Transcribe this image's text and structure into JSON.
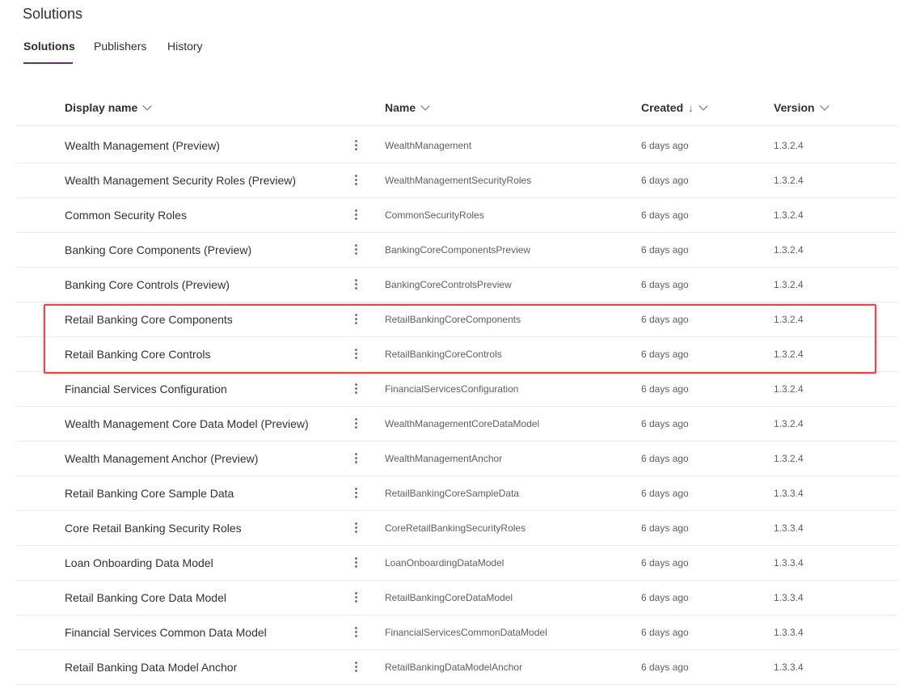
{
  "page": {
    "title": "Solutions"
  },
  "tabs": [
    {
      "label": "Solutions",
      "active": true
    },
    {
      "label": "Publishers",
      "active": false
    },
    {
      "label": "History",
      "active": false
    }
  ],
  "columns": {
    "display_name": "Display name",
    "name": "Name",
    "created": "Created",
    "created_sort_icon": "↓",
    "version": "Version"
  },
  "rows": [
    {
      "display": "Wealth Management (Preview)",
      "name": "WealthManagement",
      "created": "6 days ago",
      "version": "1.3.2.4"
    },
    {
      "display": "Wealth Management Security Roles (Preview)",
      "name": "WealthManagementSecurityRoles",
      "created": "6 days ago",
      "version": "1.3.2.4"
    },
    {
      "display": "Common Security Roles",
      "name": "CommonSecurityRoles",
      "created": "6 days ago",
      "version": "1.3.2.4"
    },
    {
      "display": "Banking Core Components (Preview)",
      "name": "BankingCoreComponentsPreview",
      "created": "6 days ago",
      "version": "1.3.2.4"
    },
    {
      "display": "Banking Core Controls (Preview)",
      "name": "BankingCoreControlsPreview",
      "created": "6 days ago",
      "version": "1.3.2.4"
    },
    {
      "display": "Retail Banking Core Components",
      "name": "RetailBankingCoreComponents",
      "created": "6 days ago",
      "version": "1.3.2.4"
    },
    {
      "display": "Retail Banking Core Controls",
      "name": "RetailBankingCoreControls",
      "created": "6 days ago",
      "version": "1.3.2.4"
    },
    {
      "display": "Financial Services Configuration",
      "name": "FinancialServicesConfiguration",
      "created": "6 days ago",
      "version": "1.3.2.4"
    },
    {
      "display": "Wealth Management Core Data Model (Preview)",
      "name": "WealthManagementCoreDataModel",
      "created": "6 days ago",
      "version": "1.3.2.4"
    },
    {
      "display": "Wealth Management Anchor (Preview)",
      "name": "WealthManagementAnchor",
      "created": "6 days ago",
      "version": "1.3.2.4"
    },
    {
      "display": "Retail Banking Core Sample Data",
      "name": "RetailBankingCoreSampleData",
      "created": "6 days ago",
      "version": "1.3.3.4"
    },
    {
      "display": "Core Retail Banking Security Roles",
      "name": "CoreRetailBankingSecurityRoles",
      "created": "6 days ago",
      "version": "1.3.3.4"
    },
    {
      "display": "Loan Onboarding Data Model",
      "name": "LoanOnboardingDataModel",
      "created": "6 days ago",
      "version": "1.3.3.4"
    },
    {
      "display": "Retail Banking Core Data Model",
      "name": "RetailBankingCoreDataModel",
      "created": "6 days ago",
      "version": "1.3.3.4"
    },
    {
      "display": "Financial Services Common Data Model",
      "name": "FinancialServicesCommonDataModel",
      "created": "6 days ago",
      "version": "1.3.3.4"
    },
    {
      "display": "Retail Banking Data Model Anchor",
      "name": "RetailBankingDataModelAnchor",
      "created": "6 days ago",
      "version": "1.3.3.4"
    }
  ],
  "colors": {
    "accent": "#742774",
    "highlight": "#e0474f"
  },
  "icons": {
    "more": "more-vertical-icon",
    "sort": "arrow-down-icon",
    "chevron": "chevron-down-icon"
  }
}
